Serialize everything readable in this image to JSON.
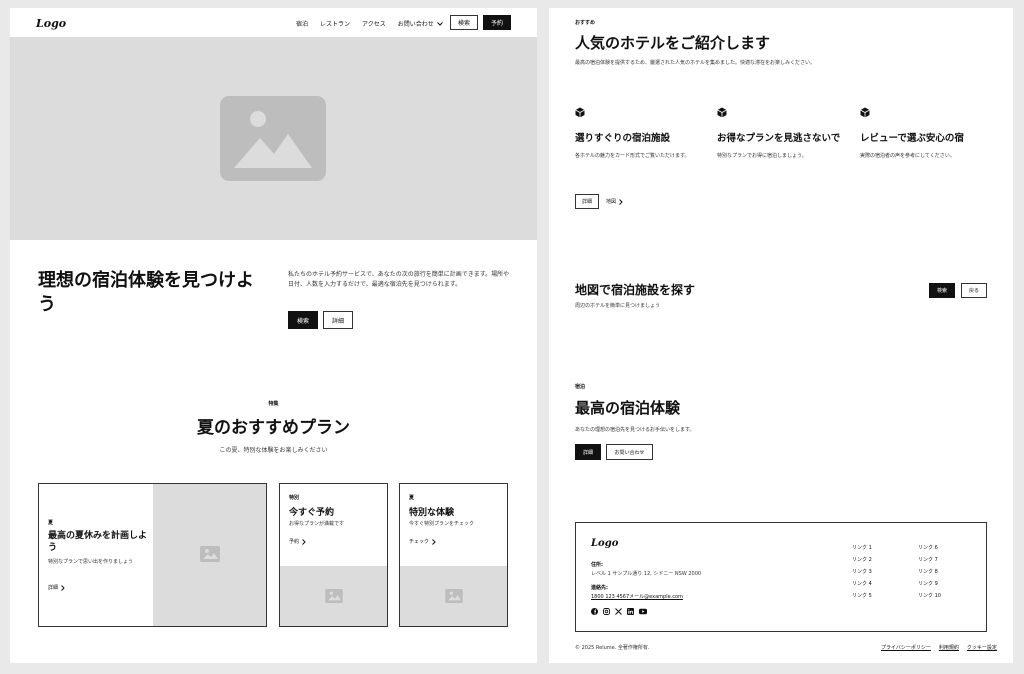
{
  "header": {
    "logo": "Logo",
    "nav": [
      "宿泊",
      "レストラン",
      "アクセス"
    ],
    "contact": "お問い合わせ",
    "search_button": "検索",
    "reserve_button": "予約"
  },
  "hero": {
    "title": "理想の宿泊体験を見つけよう",
    "description": "私たちのホテル予約サービスで、あなたの次の旅行を簡単に計画できます。場所や日付、人数を入力するだけで、最適な宿泊先を見つけられます。",
    "search_button": "検索",
    "details_button": "詳細"
  },
  "summer": {
    "tag": "特集",
    "title": "夏のおすすめプラン",
    "subtitle": "この夏、特別な体験をお楽しみください",
    "cards": [
      {
        "tag": "夏",
        "title": "最高の夏休みを計画しよう",
        "desc": "特別なプランで思い出を作りましょう",
        "link": "詳細"
      },
      {
        "tag": "特別",
        "title": "今すぐ予約",
        "desc": "お得なプランが満載です",
        "link": "予約"
      },
      {
        "tag": "夏",
        "title": "特別な体験",
        "desc": "今すぐ特別プランをチェック",
        "link": "チェック"
      }
    ]
  },
  "popular": {
    "tag": "おすすめ",
    "title": "人気のホテルをご紹介します",
    "description": "最高の宿泊体験を提供するため、厳選された人気のホテルを集めました。快適な滞在をお楽しみください。",
    "features": [
      {
        "icon": "cube-icon",
        "title": "選りすぐりの宿泊施設",
        "desc": "各ホテルの魅力をカード形式でご覧いただけます。"
      },
      {
        "icon": "cube-icon",
        "title": "お得なプランを見逃さないで",
        "desc": "特別なプランでお得に宿泊しましょう。"
      },
      {
        "icon": "cube-icon",
        "title": "レビューで選ぶ安心の宿",
        "desc": "実際の宿泊者の声を参考にしてください。"
      }
    ],
    "details_button": "詳細",
    "map_link": "地図"
  },
  "map": {
    "title": "地図で宿泊施設を探す",
    "description": "周辺のホテルを簡単に見つけましょう",
    "search_button": "検索",
    "back_button": "戻る"
  },
  "best": {
    "tag": "宿泊",
    "title": "最高の宿泊体験",
    "description": "あなたの理想の宿泊先を見つけるお手伝いをします。",
    "details_button": "詳細",
    "contact_button": "お問い合わせ"
  },
  "footer": {
    "logo": "Logo",
    "address_label": "住所:",
    "address": "レベル 1 サンプル通り 12, シドニー NSW 2000",
    "contact_label": "連絡先:",
    "contact": "1800 123 4567メール@example.com",
    "links_col1": [
      "リンク 1",
      "リンク 2",
      "リンク 3",
      "リンク 4",
      "リンク 5"
    ],
    "links_col2": [
      "リンク 6",
      "リンク 7",
      "リンク 8",
      "リンク 9",
      "リンク 10"
    ],
    "copyright": "© 2025 Relume. 全著作権所有.",
    "privacy": "プライバシーポリシー",
    "terms": "利用規約",
    "cookies": "クッキー設定"
  }
}
